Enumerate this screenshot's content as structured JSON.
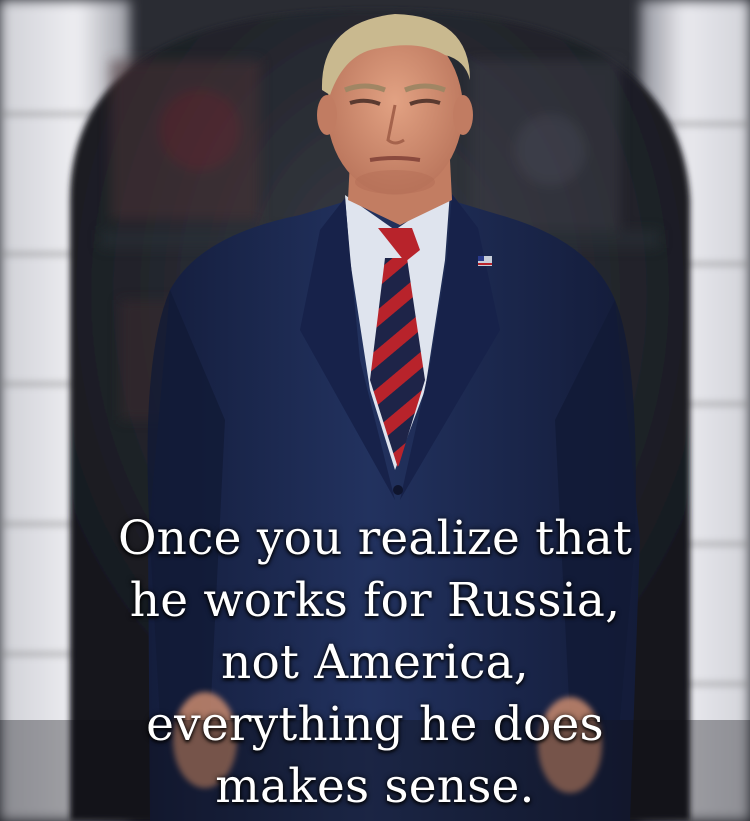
{
  "caption": {
    "lines": [
      "Once you realize that",
      "he works for Russia,",
      "not America,",
      "everything he does",
      "makes sense."
    ]
  },
  "colors": {
    "suit": "#1c2a52",
    "shirt": "#dfe4ee",
    "tie_red": "#b8232b",
    "tie_navy": "#1e2448",
    "hair": "#c9b98f",
    "skin": "#d89477",
    "background_pillar": "#e8e8ec",
    "doorway": "#23262e",
    "caption_text": "#ffffff"
  }
}
